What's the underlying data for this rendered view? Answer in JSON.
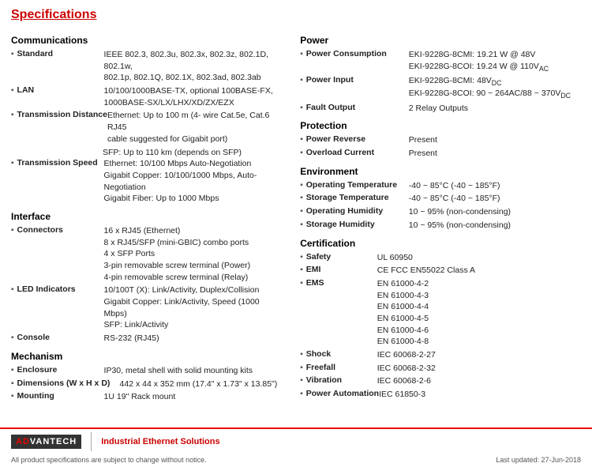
{
  "page": {
    "title": "Specifications"
  },
  "left": {
    "section_communications": "Communications",
    "section_interface": "Interface",
    "section_mechanism": "Mechanism",
    "specs": {
      "standard_label": "Standard",
      "standard_value": "IEEE 802.3, 802.3u, 802.3x, 802.3z, 802.1D, 802.1w,\n802.1p, 802.1Q, 802.1X, 802.3ad, 802.3ab",
      "lan_label": "LAN",
      "lan_value": "10/100/1000BASE-TX, optional 100BASE-FX,\n1000BASE-SX/LX/LHX/XD/ZX/EZX",
      "tx_dist_label": "Transmission Distance",
      "tx_dist_value": "Ethernet: Up to 100 m (4- wire Cat.5e, Cat.6 RJ45\ncable suggested for Gigabit port)",
      "tx_dist_value2": "SFP: Up to 110 km (depends on SFP)",
      "tx_speed_label": "Transmission Speed",
      "tx_speed_value": "Ethernet: 10/100 Mbps Auto-Negotiation\nGigabit Copper: 10/100/1000 Mbps, Auto-Negotiation\nGigabit Fiber: Up to 1000 Mbps",
      "connectors_label": "Connectors",
      "connectors_value": "16 x RJ45 (Ethernet)\n8 x RJ45/SFP (mini-GBIC) combo ports\n4 x SFP Ports\n3-pin removable screw terminal (Power)\n4-pin removable screw terminal (Relay)",
      "led_label": "LED Indicators",
      "led_value": "10/100T (X): Link/Activity, Duplex/Collision\nGigabit Copper: Link/Activity, Speed (1000 Mbps)\nSFP: Link/Activity",
      "console_label": "Console",
      "console_value": "RS-232 (RJ45)",
      "enclosure_label": "Enclosure",
      "enclosure_value": "IP30, metal shell with solid mounting kits",
      "dimensions_label": "Dimensions (W x H x D)",
      "dimensions_value": "442 x 44 x 352 mm (17.4\" x 1.73\" x 13.85\")",
      "mounting_label": "Mounting",
      "mounting_value": "1U 19\" Rack mount"
    }
  },
  "right": {
    "section_power": "Power",
    "section_protection": "Protection",
    "section_environment": "Environment",
    "section_certification": "Certification",
    "specs": {
      "power_consumption_label": "Power Consumption",
      "power_consumption_value": "EKI-9228G-8CMI: 19.21 W @ 48V\nEKI-9228G-8COI: 19.24 W @ 110VAC",
      "power_input_label": "Power Input",
      "power_input_value": "EKI-9228G-8CMI: 48VDC\nEKI-9228G-8COI: 90 ~ 264AC/88 ~ 370VDC",
      "fault_output_label": "Fault Output",
      "fault_output_value": "2 Relay Outputs",
      "power_reverse_label": "Power Reverse",
      "power_reverse_value": "Present",
      "overload_label": "Overload Current",
      "overload_value": "Present",
      "operating_temp_label": "Operating Temperature",
      "operating_temp_value": "-40 ~ 85°C (-40 ~ 185°F)",
      "storage_temp_label": "Storage Temperature",
      "storage_temp_value": "-40 ~ 85°C (-40 ~ 185°F)",
      "operating_humidity_label": "Operating Humidity",
      "operating_humidity_value": "10 ~ 95% (non-condensing)",
      "storage_humidity_label": "Storage Humidity",
      "storage_humidity_value": "10 ~ 95% (non-condensing)",
      "safety_label": "Safety",
      "safety_value": "UL 60950",
      "emi_label": "EMI",
      "emi_value": "CE FCC EN55022 Class A",
      "ems_label": "EMS",
      "ems_value": "EN 61000-4-2\nEN 61000-4-3\nEN 61000-4-4\nEN 61000-4-5\nEN 61000-4-6\nEN 61000-4-8",
      "shock_label": "Shock",
      "shock_value": "IEC 60068-2-27",
      "freefall_label": "Freefall",
      "freefall_value": "IEC 60068-2-32",
      "vibration_label": "Vibration",
      "vibration_value": "IEC 60068-2-6",
      "power_automation_label": "Power Automation",
      "power_automation_value": "IEC 61850-3"
    }
  },
  "footer": {
    "logo_ad": "AD",
    "logo_vantech": "VANTECH",
    "tagline": "Industrial Ethernet Solutions",
    "notice": "All product specifications are subject to change without notice.",
    "last_updated": "Last updated: 27-Jun-2018"
  }
}
